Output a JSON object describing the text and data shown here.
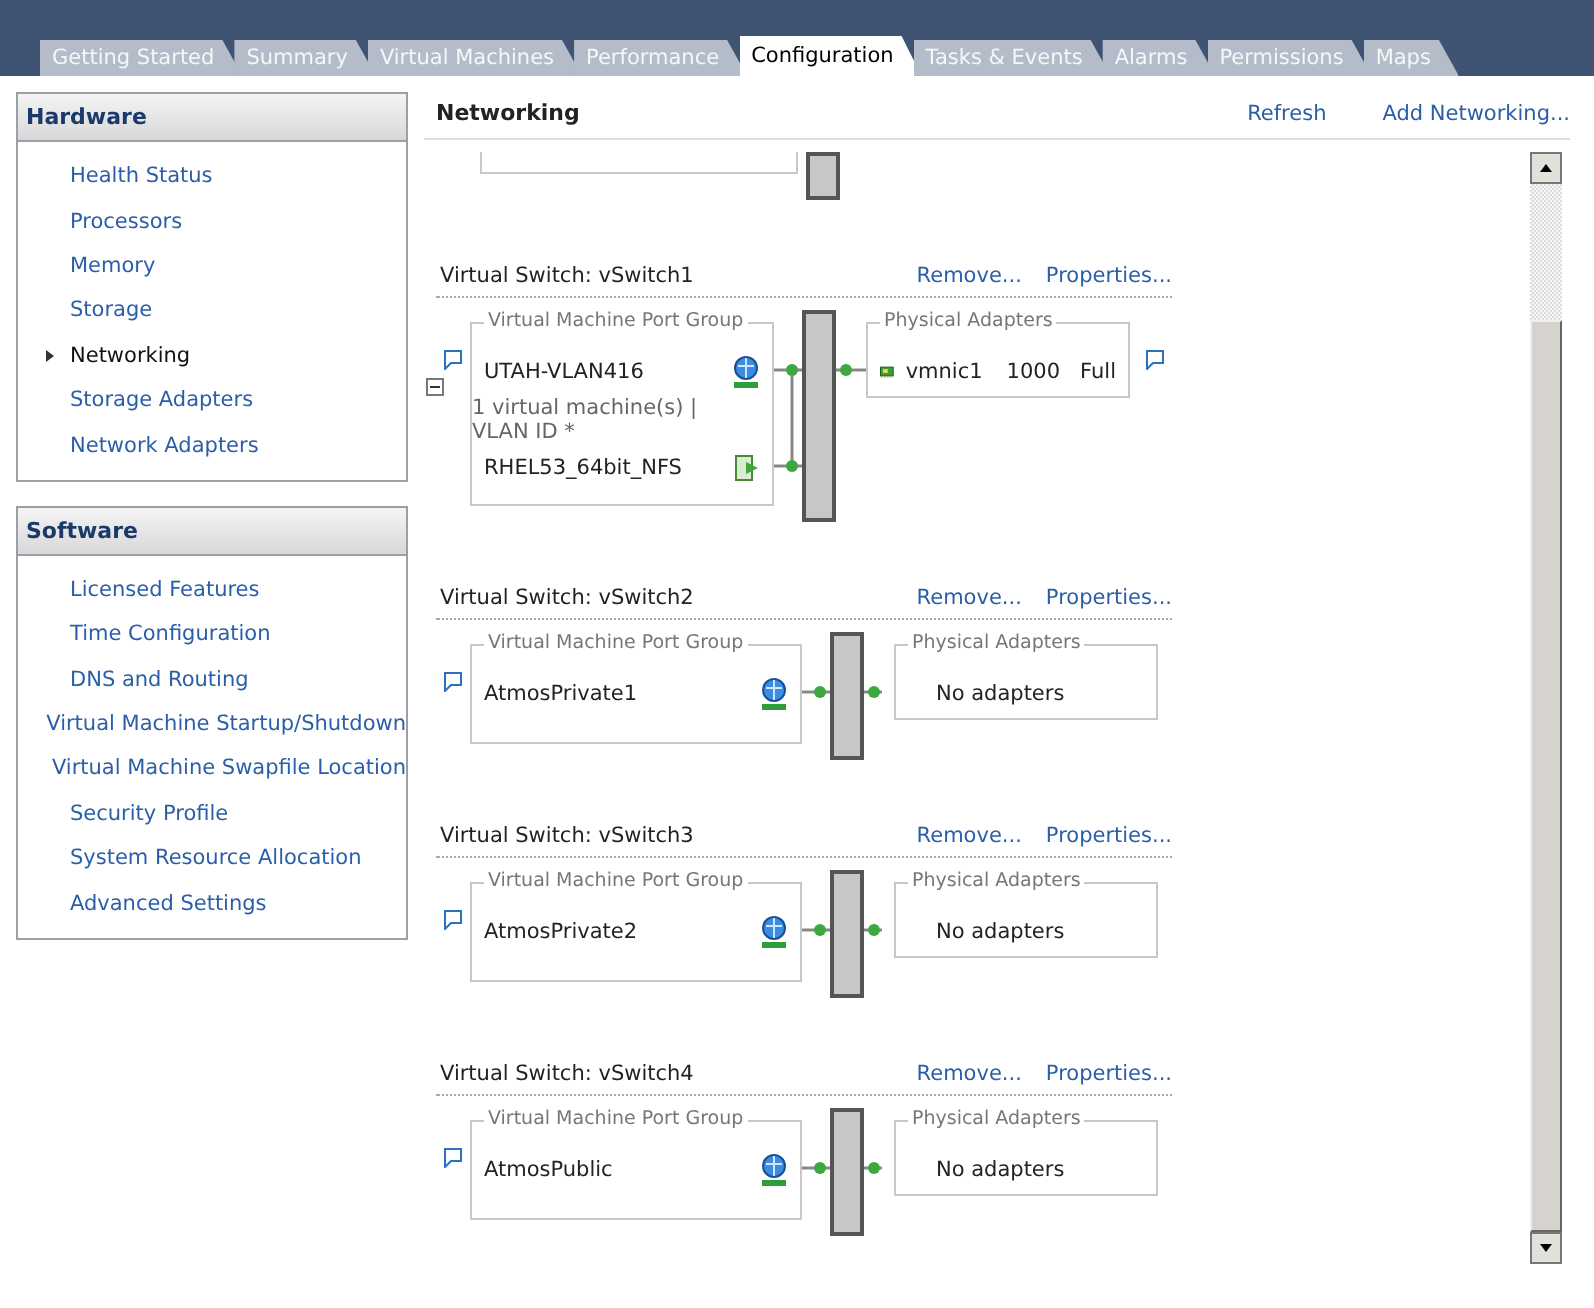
{
  "tabs": [
    {
      "label": "Getting Started",
      "selected": false
    },
    {
      "label": "Summary",
      "selected": false
    },
    {
      "label": "Virtual Machines",
      "selected": false
    },
    {
      "label": "Performance",
      "selected": false
    },
    {
      "label": "Configuration",
      "selected": true
    },
    {
      "label": "Tasks & Events",
      "selected": false
    },
    {
      "label": "Alarms",
      "selected": false
    },
    {
      "label": "Permissions",
      "selected": false
    },
    {
      "label": "Maps",
      "selected": false
    }
  ],
  "sidebar": [
    {
      "title": "Hardware",
      "items": [
        {
          "label": "Health Status",
          "selected": false
        },
        {
          "label": "Processors",
          "selected": false
        },
        {
          "label": "Memory",
          "selected": false
        },
        {
          "label": "Storage",
          "selected": false
        },
        {
          "label": "Networking",
          "selected": true
        },
        {
          "label": "Storage Adapters",
          "selected": false
        },
        {
          "label": "Network Adapters",
          "selected": false
        }
      ]
    },
    {
      "title": "Software",
      "items": [
        {
          "label": "Licensed Features",
          "selected": false
        },
        {
          "label": "Time Configuration",
          "selected": false
        },
        {
          "label": "DNS and Routing",
          "selected": false
        },
        {
          "label": "Virtual Machine Startup/Shutdown",
          "selected": false
        },
        {
          "label": "Virtual Machine Swapfile Location",
          "selected": false
        },
        {
          "label": "Security Profile",
          "selected": false
        },
        {
          "label": "System Resource Allocation",
          "selected": false
        },
        {
          "label": "Advanced Settings",
          "selected": false
        }
      ]
    }
  ],
  "networking": {
    "title": "Networking",
    "actions": [
      "Refresh",
      "Add Networking..."
    ],
    "switches": [
      {
        "title": "Virtual Switch: vSwitch1",
        "actions": [
          "Remove...",
          "Properties..."
        ],
        "port_group": {
          "legend": "Virtual Machine Port Group",
          "name": "UTAH-VLAN416",
          "expanded": true,
          "detail": "1 virtual machine(s) | VLAN ID *",
          "vms": [
            "RHEL53_64bit_NFS"
          ]
        },
        "adapters": {
          "legend": "Physical Adapters",
          "items": [
            {
              "name": "vmnic1",
              "speed": "1000",
              "duplex": "Full"
            }
          ]
        }
      },
      {
        "title": "Virtual Switch: vSwitch2",
        "actions": [
          "Remove...",
          "Properties..."
        ],
        "port_group": {
          "legend": "Virtual Machine Port Group",
          "name": "AtmosPrivate1"
        },
        "adapters": {
          "legend": "Physical Adapters",
          "empty_text": "No adapters"
        }
      },
      {
        "title": "Virtual Switch: vSwitch3",
        "actions": [
          "Remove...",
          "Properties..."
        ],
        "port_group": {
          "legend": "Virtual Machine Port Group",
          "name": "AtmosPrivate2"
        },
        "adapters": {
          "legend": "Physical Adapters",
          "empty_text": "No adapters"
        }
      },
      {
        "title": "Virtual Switch: vSwitch4",
        "actions": [
          "Remove...",
          "Properties..."
        ],
        "port_group": {
          "legend": "Virtual Machine Port Group",
          "name": "AtmosPublic"
        },
        "adapters": {
          "legend": "Physical Adapters",
          "empty_text": "No adapters"
        }
      }
    ]
  }
}
